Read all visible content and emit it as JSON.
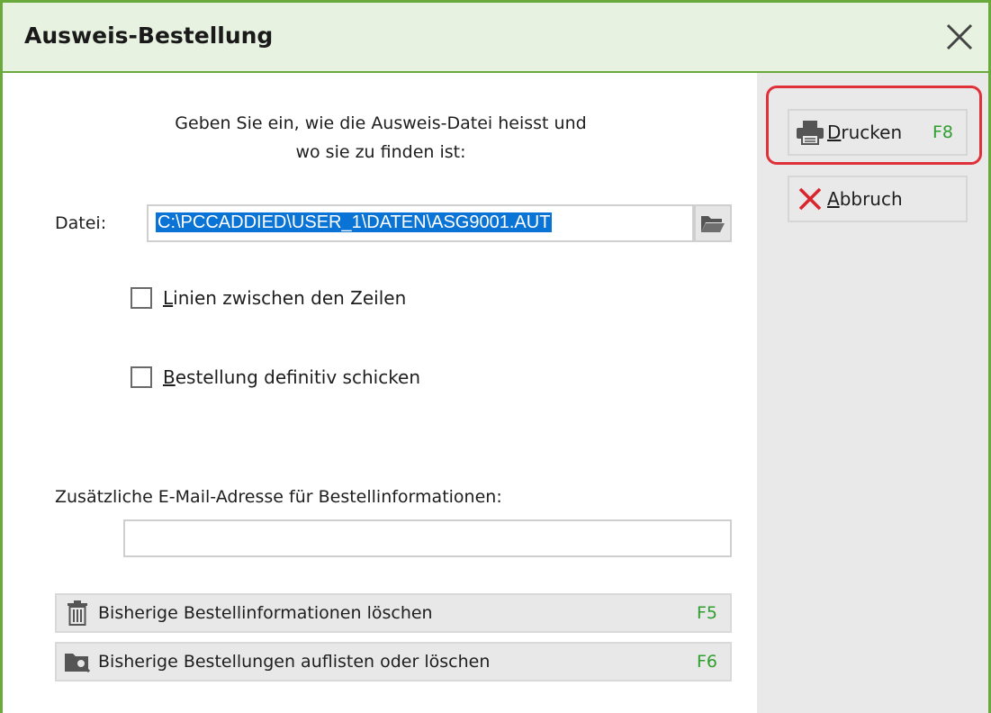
{
  "window": {
    "title": "Ausweis-Bestellung"
  },
  "form": {
    "heading_line1": "Geben Sie ein, wie die Ausweis-Datei heisst und",
    "heading_line2": "wo sie zu finden ist:",
    "file_label": "Datei:",
    "file_value": "C:\\PCCADDIED\\USER_1\\DATEN\\ASG9001.AUT",
    "checkbox_lines_rest": "inien zwischen den Zeilen",
    "checkbox_lines_mnemonic": "L",
    "checkbox_lines_checked": false,
    "checkbox_send_rest": "estellung definitiv schicken",
    "checkbox_send_mnemonic": "B",
    "checkbox_send_checked": false,
    "email_label": "Zusätzliche E-Mail-Adresse für Bestellinformationen:",
    "email_value": ""
  },
  "actions": {
    "delete_info_label": "Bisherige Bestellinformationen löschen",
    "delete_info_key": "F5",
    "list_orders_label": "Bisherige Bestellungen auflisten oder löschen",
    "list_orders_key": "F6"
  },
  "sidebar": {
    "print_mnemonic": "D",
    "print_rest": "rucken",
    "print_key": "F8",
    "cancel_mnemonic": "A",
    "cancel_rest": "bbruch"
  },
  "icons": {
    "close": "close-icon",
    "print": "printer-icon",
    "cancel": "x-icon",
    "folder": "folder-open-icon",
    "trash": "trash-icon",
    "list": "folder-search-icon"
  },
  "colors": {
    "accent_green": "#6aaa3c",
    "titlebar_bg": "#e7f2e1",
    "shortcut_green": "#2e9e2e",
    "highlight_red": "#e0303a",
    "selection_blue": "#0a74d6",
    "cancel_red": "#d9262e"
  }
}
